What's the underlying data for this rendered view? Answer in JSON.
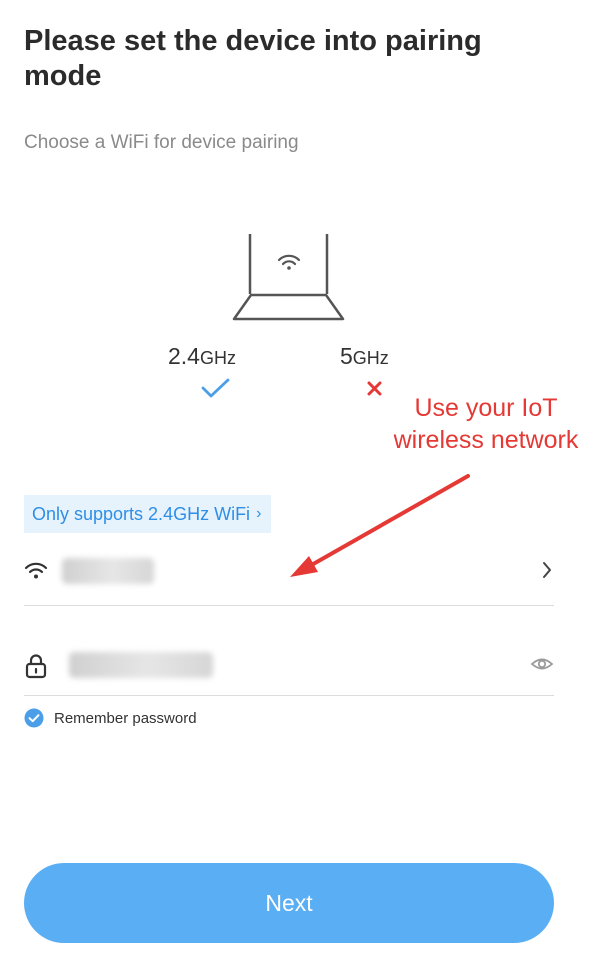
{
  "header": {
    "title": "Please set the device into pairing mode",
    "subtitle": "Choose a WiFi for device pairing"
  },
  "bands": {
    "supported": {
      "value": "2.4",
      "unit": "GHz",
      "status_icon": "check-icon"
    },
    "unsupported": {
      "value": "5",
      "unit": "GHz",
      "status_icon": "cross-icon"
    }
  },
  "annotation": {
    "line1": "Use your IoT",
    "line2": "wireless network",
    "color": "#e53935"
  },
  "support_tag": {
    "label": "Only supports 2.4GHz WiFi",
    "chevron": "›"
  },
  "wifi_field": {
    "value": "•••••",
    "icon": "wifi-icon",
    "trailing_icon": "chevron-right-icon"
  },
  "password_field": {
    "value": "••••••••••",
    "icon": "lock-icon",
    "trailing_icon": "eye-icon"
  },
  "remember": {
    "label": "Remember password",
    "checked": true
  },
  "next_button": {
    "label": "Next"
  },
  "colors": {
    "accent": "#5aaef3",
    "check": "#4a9fe8",
    "tag_bg": "#e6f3fd",
    "tag_text": "#2f8ee6",
    "cross": "#e53935"
  }
}
